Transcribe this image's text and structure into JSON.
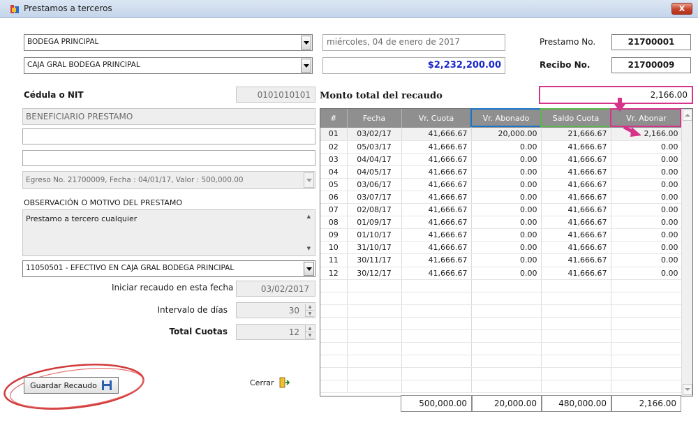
{
  "window": {
    "title": "Prestamos a terceros",
    "close_label": "X"
  },
  "header": {
    "warehouse": "BODEGA PRINCIPAL",
    "cashbox": "CAJA GRAL BODEGA PRINCIPAL",
    "date": "miércoles, 04 de enero de 2017",
    "balance": "$2,232,200.00",
    "loan_no_label": "Prestamo No.",
    "loan_no": "21700001",
    "receipt_no_label": "Recibo No.",
    "receipt_no": "21700009"
  },
  "form": {
    "id_label": "Cédula o NIT",
    "id_value": "0101010101",
    "beneficiary": "BENEFICIARIO PRESTAMO",
    "extra1": "",
    "extra2": "",
    "egreso": "Egreso No. 21700009, Fecha : 04/01/17, Valor : 500,000.00",
    "obs_label": "OBSERVACIÓN O MOTIVO DEL PRESTAMO",
    "obs_value": "Prestamo a tercero cualquier",
    "account": "11050501 - EFECTIVO EN CAJA GRAL BODEGA PRINCIPAL",
    "start_label": "Iniciar recaudo en esta fecha",
    "start_value": "03/02/2017",
    "interval_label": "Intervalo de días",
    "interval_value": "30",
    "total_label": "Total Cuotas",
    "total_value": "12"
  },
  "collection": {
    "label": "Monto total del recaudo",
    "value": "2,166.00"
  },
  "table": {
    "columns": [
      "#",
      "Fecha",
      "Vr. Cuota",
      "Vr. Abonado",
      "Saldo Cuota",
      "Vr. Abonar"
    ],
    "rows": [
      [
        "01",
        "03/02/17",
        "41,666.67",
        "20,000.00",
        "21,666.67",
        "2,166.00"
      ],
      [
        "02",
        "05/03/17",
        "41,666.67",
        "0.00",
        "41,666.67",
        "0.00"
      ],
      [
        "03",
        "04/04/17",
        "41,666.67",
        "0.00",
        "41,666.67",
        "0.00"
      ],
      [
        "04",
        "04/05/17",
        "41,666.67",
        "0.00",
        "41,666.67",
        "0.00"
      ],
      [
        "05",
        "03/06/17",
        "41,666.67",
        "0.00",
        "41,666.67",
        "0.00"
      ],
      [
        "06",
        "03/07/17",
        "41,666.67",
        "0.00",
        "41,666.67",
        "0.00"
      ],
      [
        "07",
        "02/08/17",
        "41,666.67",
        "0.00",
        "41,666.67",
        "0.00"
      ],
      [
        "08",
        "01/09/17",
        "41,666.67",
        "0.00",
        "41,666.67",
        "0.00"
      ],
      [
        "09",
        "01/10/17",
        "41,666.67",
        "0.00",
        "41,666.67",
        "0.00"
      ],
      [
        "10",
        "31/10/17",
        "41,666.67",
        "0.00",
        "41,666.67",
        "0.00"
      ],
      [
        "11",
        "30/11/17",
        "41,666.67",
        "0.00",
        "41,666.67",
        "0.00"
      ],
      [
        "12",
        "30/12/17",
        "41,666.67",
        "0.00",
        "41,666.67",
        "0.00"
      ]
    ],
    "totals": [
      "500,000.00",
      "20,000.00",
      "480,000.00",
      "2,166.00"
    ]
  },
  "buttons": {
    "save_label": "Guardar Recaudo",
    "close_label": "Cerrar"
  },
  "icons": {
    "app": "app-icon",
    "save": "floppy-disk-icon",
    "close": "exit-door-icon",
    "dropdown": "chevron-down-icon",
    "spin": "spin-arrows-icon"
  },
  "colors": {
    "highlight_blue": "#1c74c9",
    "highlight_green": "#5ab74a",
    "highlight_pink": "#d6338b",
    "balance_text": "#1a27c8",
    "annotation_red": "#d23b3b"
  }
}
